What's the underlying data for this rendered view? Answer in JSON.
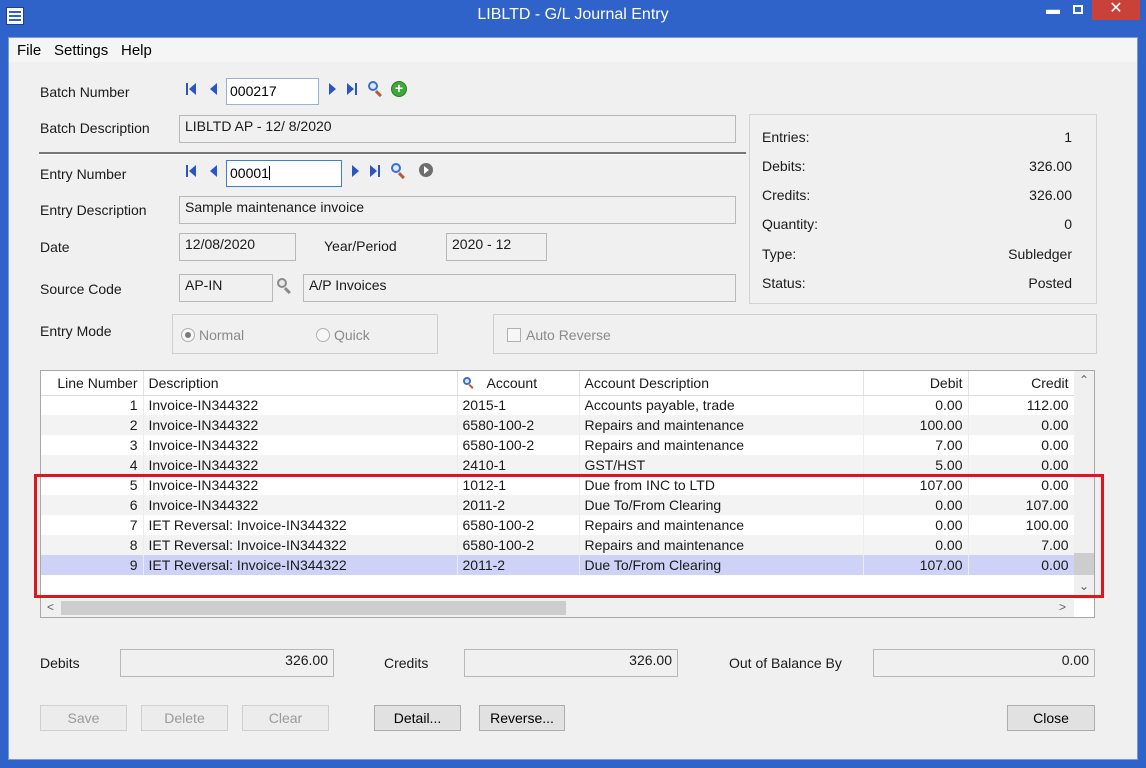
{
  "window": {
    "title": "LIBLTD - G/L Journal Entry",
    "close_glyph": "✕",
    "min_glyph": "▬"
  },
  "menu": {
    "file": "File",
    "settings": "Settings",
    "help": "Help"
  },
  "batch": {
    "number_label": "Batch Number",
    "number": "000217",
    "description_label": "Batch Description",
    "description": "LIBLTD AP - 12/ 8/2020"
  },
  "entry": {
    "number_label": "Entry Number",
    "number": "00001",
    "description_label": "Entry Description",
    "description": "Sample maintenance invoice",
    "date_label": "Date",
    "date": "12/08/2020",
    "year_period_label": "Year/Period",
    "year_period": "2020 - 12",
    "source_code_label": "Source Code",
    "source_code": "AP-IN",
    "source_description": "A/P Invoices",
    "mode_label": "Entry Mode",
    "mode_normal": "Normal",
    "mode_quick": "Quick",
    "mode_selected": "Normal",
    "auto_reverse": "Auto Reverse"
  },
  "summary": {
    "entries_label": "Entries:",
    "entries": "1",
    "debits_label": "Debits:",
    "debits": "326.00",
    "credits_label": "Credits:",
    "credits": "326.00",
    "quantity_label": "Quantity:",
    "quantity": "0",
    "type_label": "Type:",
    "type": "Subledger",
    "status_label": "Status:",
    "status": "Posted"
  },
  "grid": {
    "headers": {
      "line": "Line Number",
      "description": "Description",
      "account": "Account",
      "account_description": "Account Description",
      "debit": "Debit",
      "credit": "Credit"
    },
    "rows": [
      {
        "line": "1",
        "description": "Invoice-IN344322",
        "account": "2015-1",
        "account_description": "Accounts payable, trade",
        "debit": "0.00",
        "credit": "112.00"
      },
      {
        "line": "2",
        "description": "Invoice-IN344322",
        "account": "6580-100-2",
        "account_description": "Repairs and maintenance",
        "debit": "100.00",
        "credit": "0.00"
      },
      {
        "line": "3",
        "description": "Invoice-IN344322",
        "account": "6580-100-2",
        "account_description": "Repairs and maintenance",
        "debit": "7.00",
        "credit": "0.00"
      },
      {
        "line": "4",
        "description": "Invoice-IN344322",
        "account": "2410-1",
        "account_description": "GST/HST",
        "debit": "5.00",
        "credit": "0.00"
      },
      {
        "line": "5",
        "description": "Invoice-IN344322",
        "account": "1012-1",
        "account_description": "Due from INC to LTD",
        "debit": "107.00",
        "credit": "0.00"
      },
      {
        "line": "6",
        "description": "Invoice-IN344322",
        "account": "2011-2",
        "account_description": "Due To/From Clearing",
        "debit": "0.00",
        "credit": "107.00"
      },
      {
        "line": "7",
        "description": "IET Reversal: Invoice-IN344322",
        "account": "6580-100-2",
        "account_description": "Repairs and maintenance",
        "debit": "0.00",
        "credit": "100.00"
      },
      {
        "line": "8",
        "description": "IET Reversal: Invoice-IN344322",
        "account": "6580-100-2",
        "account_description": "Repairs and maintenance",
        "debit": "0.00",
        "credit": "7.00"
      },
      {
        "line": "9",
        "description": "IET Reversal: Invoice-IN344322",
        "account": "2011-2",
        "account_description": "Due To/From Clearing",
        "debit": "107.00",
        "credit": "0.00"
      }
    ]
  },
  "totals": {
    "debits_label": "Debits",
    "debits": "326.00",
    "credits_label": "Credits",
    "credits": "326.00",
    "out_of_balance_label": "Out of Balance By",
    "out_of_balance": "0.00"
  },
  "buttons": {
    "save": "Save",
    "delete": "Delete",
    "clear": "Clear",
    "detail": "Detail...",
    "reverse": "Reverse...",
    "close": "Close"
  },
  "icons": {
    "scroll_up": "⌃",
    "scroll_down": "⌄",
    "scroll_left": "<",
    "scroll_right": ">",
    "add": "+"
  }
}
